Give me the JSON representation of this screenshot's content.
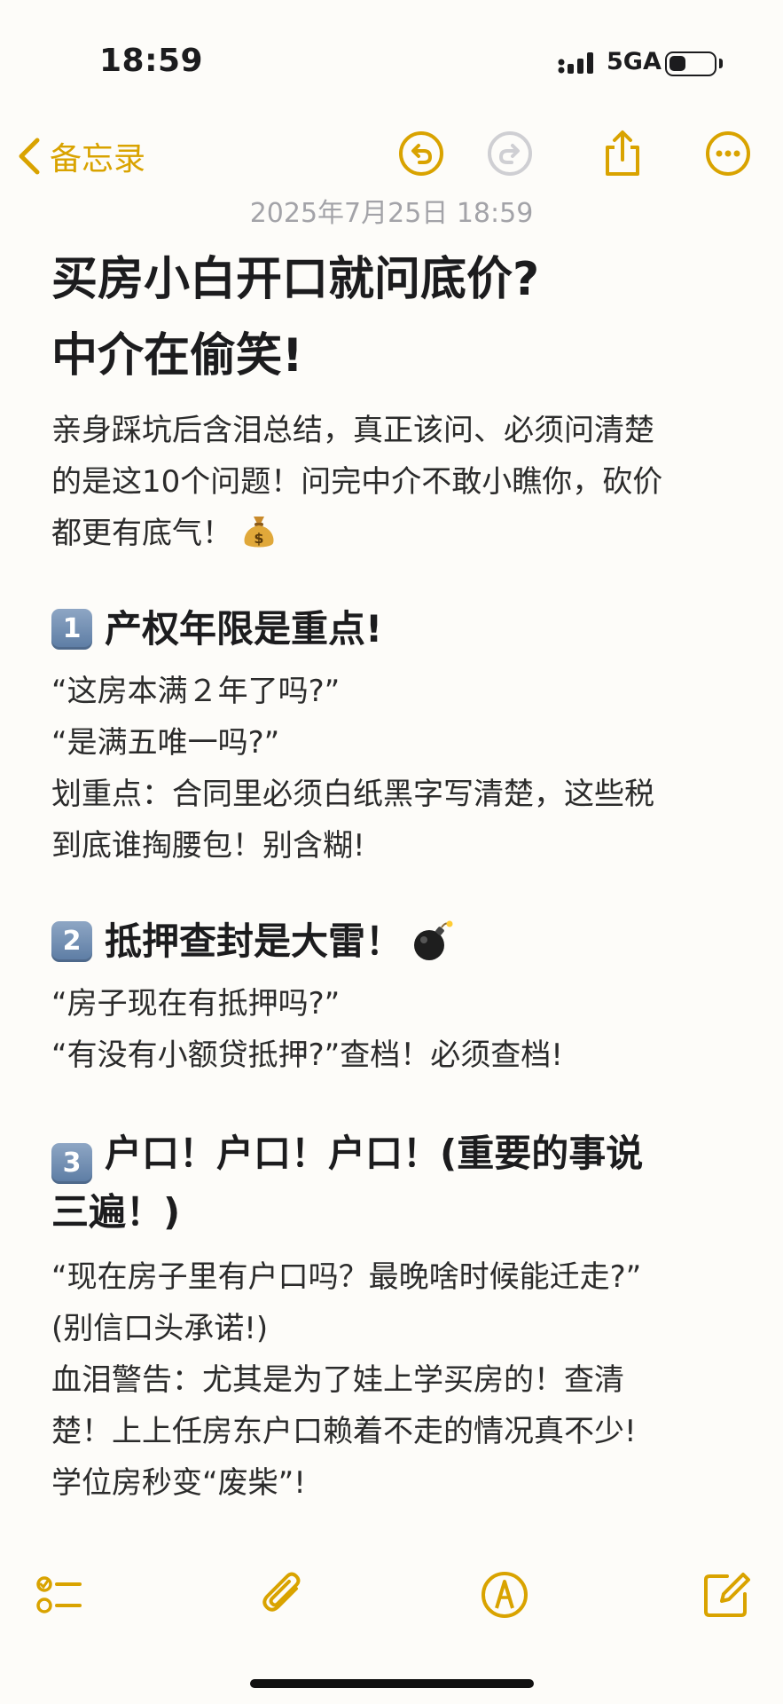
{
  "status": {
    "time": "18:59",
    "network": "5GA",
    "battery_level": 0.3
  },
  "nav": {
    "back_label": "备忘录"
  },
  "note": {
    "date": "2025年7月25日 18:59",
    "title_lines": [
      "买房小白开口就问底价?",
      "中介在偷笑!"
    ],
    "intro_lines": [
      "亲身踩坑后含泪总结，真正该问、必须问清楚",
      "的是这10个问题！问完中介不敢小瞧你，砍价",
      "都更有底气！"
    ],
    "intro_emoji": "money-bag-icon",
    "sections": [
      {
        "number": "1",
        "title": "产权年限是重点!",
        "lines": [
          "“这房本满２年了吗?”",
          "“是满五唯一吗?”",
          "划重点：合同里必须白纸黑字写清楚，这些税",
          "到底谁掏腰包！别含糊!"
        ]
      },
      {
        "number": "2",
        "title": "抵押查封是大雷！",
        "title_emoji": "bomb-icon",
        "lines": [
          "“房子现在有抵押吗?”",
          "“有没有小额贷抵押?”查档！必须查档!"
        ]
      },
      {
        "number": "3",
        "title_lines": [
          "户口！户口！户口！(重要的事说",
          "三遍！)"
        ],
        "lines": [
          "“现在房子里有户口吗？最晚啥时候能迁走?”",
          "(别信口头承诺!)",
          "血泪警告：尤其是为了娃上学买房的！查清",
          "楚！上上任房东户口赖着不走的情况真不少!",
          "学位房秒变“废柴”!"
        ]
      }
    ]
  },
  "colors": {
    "accent": "#d9a300",
    "text": "#1c1c1e",
    "date": "#a3a3a8",
    "background": "#fdfcf9"
  },
  "toolbar": {
    "icons": [
      "checklist-icon",
      "paperclip-icon",
      "markup-pen-icon",
      "compose-icon"
    ]
  }
}
